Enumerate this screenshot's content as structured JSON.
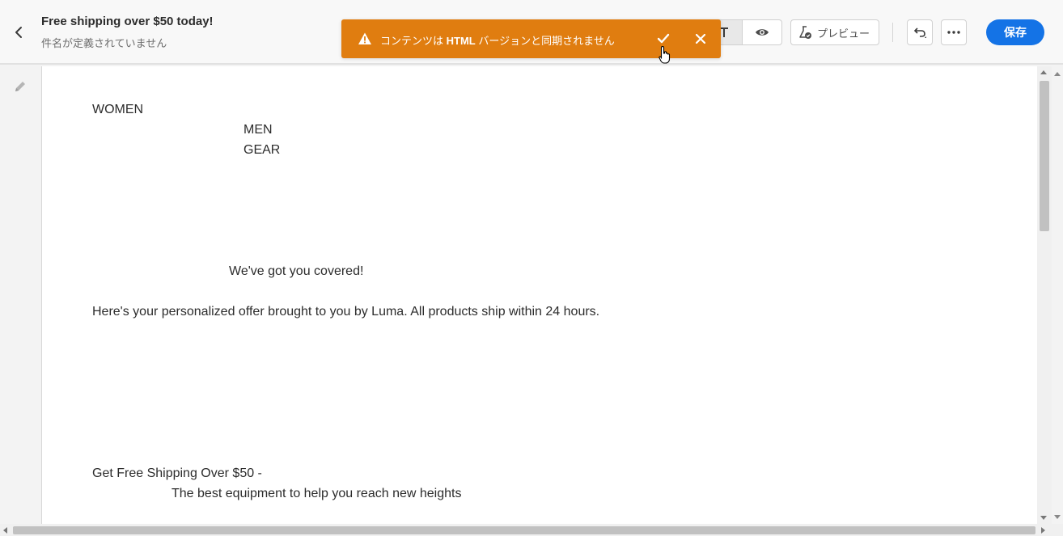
{
  "header": {
    "title": "Free shipping over $50 today!",
    "subtitle": "件名が定義されていません",
    "preview_label": "プレビュー",
    "save_label": "保存"
  },
  "toast": {
    "message_prefix": "コンテンツは ",
    "message_bold": "HTML",
    "message_suffix": " バージョンと同期されません"
  },
  "content": {
    "nav_women": "WOMEN",
    "nav_men": "MEN",
    "nav_gear": "GEAR",
    "heading": "We've got you covered!",
    "body": "Here's your personalized offer brought to you by Luma. All products ship within 24 hours.",
    "promo_title": "Get Free Shipping Over $50 -",
    "promo_subtitle": "The best equipment to help you reach new heights"
  },
  "colors": {
    "toast_bg": "#e07d10",
    "save_bg": "#1473e6"
  },
  "icons": {
    "back": "chevron-left-icon",
    "toast_warning": "warning-icon",
    "toast_confirm": "checkmark-icon",
    "toast_close": "close-icon",
    "text_mode": "text-icon",
    "view_mode": "eye-icon",
    "preview": "flask-icon",
    "undo": "undo-icon",
    "more": "more-icon",
    "edit": "pencil-icon"
  }
}
